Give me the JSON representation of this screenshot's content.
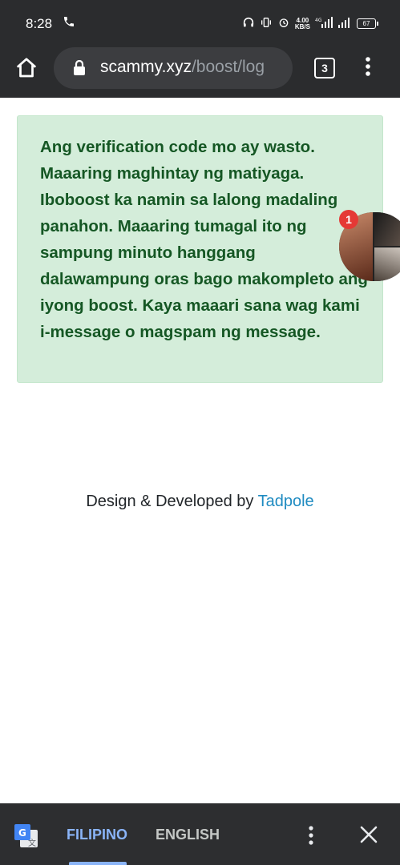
{
  "status_bar": {
    "time": "8:28",
    "net_speed_top": "4.00",
    "net_speed_bottom": "KB/S",
    "battery": "67"
  },
  "browser": {
    "url_domain": "scammy.xyz",
    "url_path": "/boost/log",
    "tab_count": "3"
  },
  "alert": {
    "message": "Ang verification code mo ay wasto. Maaaring maghintay ng matiyaga. Iboboost ka namin sa lalong madaling panahon. Maaaring tumagal ito ng sampung minuto hanggang dalawampung oras bago makompleto ang iyong boost. Kaya maaari sana wag kami i-message o magspam ng message.",
    "background": "#d4edda",
    "text_color": "#155724"
  },
  "chat_head": {
    "badge_count": "1"
  },
  "footer": {
    "credit_prefix": "Design & Developed by ",
    "credit_link": "Tadpole",
    "link_color": "#1f8bc1"
  },
  "translate_bar": {
    "tab_source": "FILIPINO",
    "tab_target": "ENGLISH",
    "active_color": "#8ab4f8"
  }
}
